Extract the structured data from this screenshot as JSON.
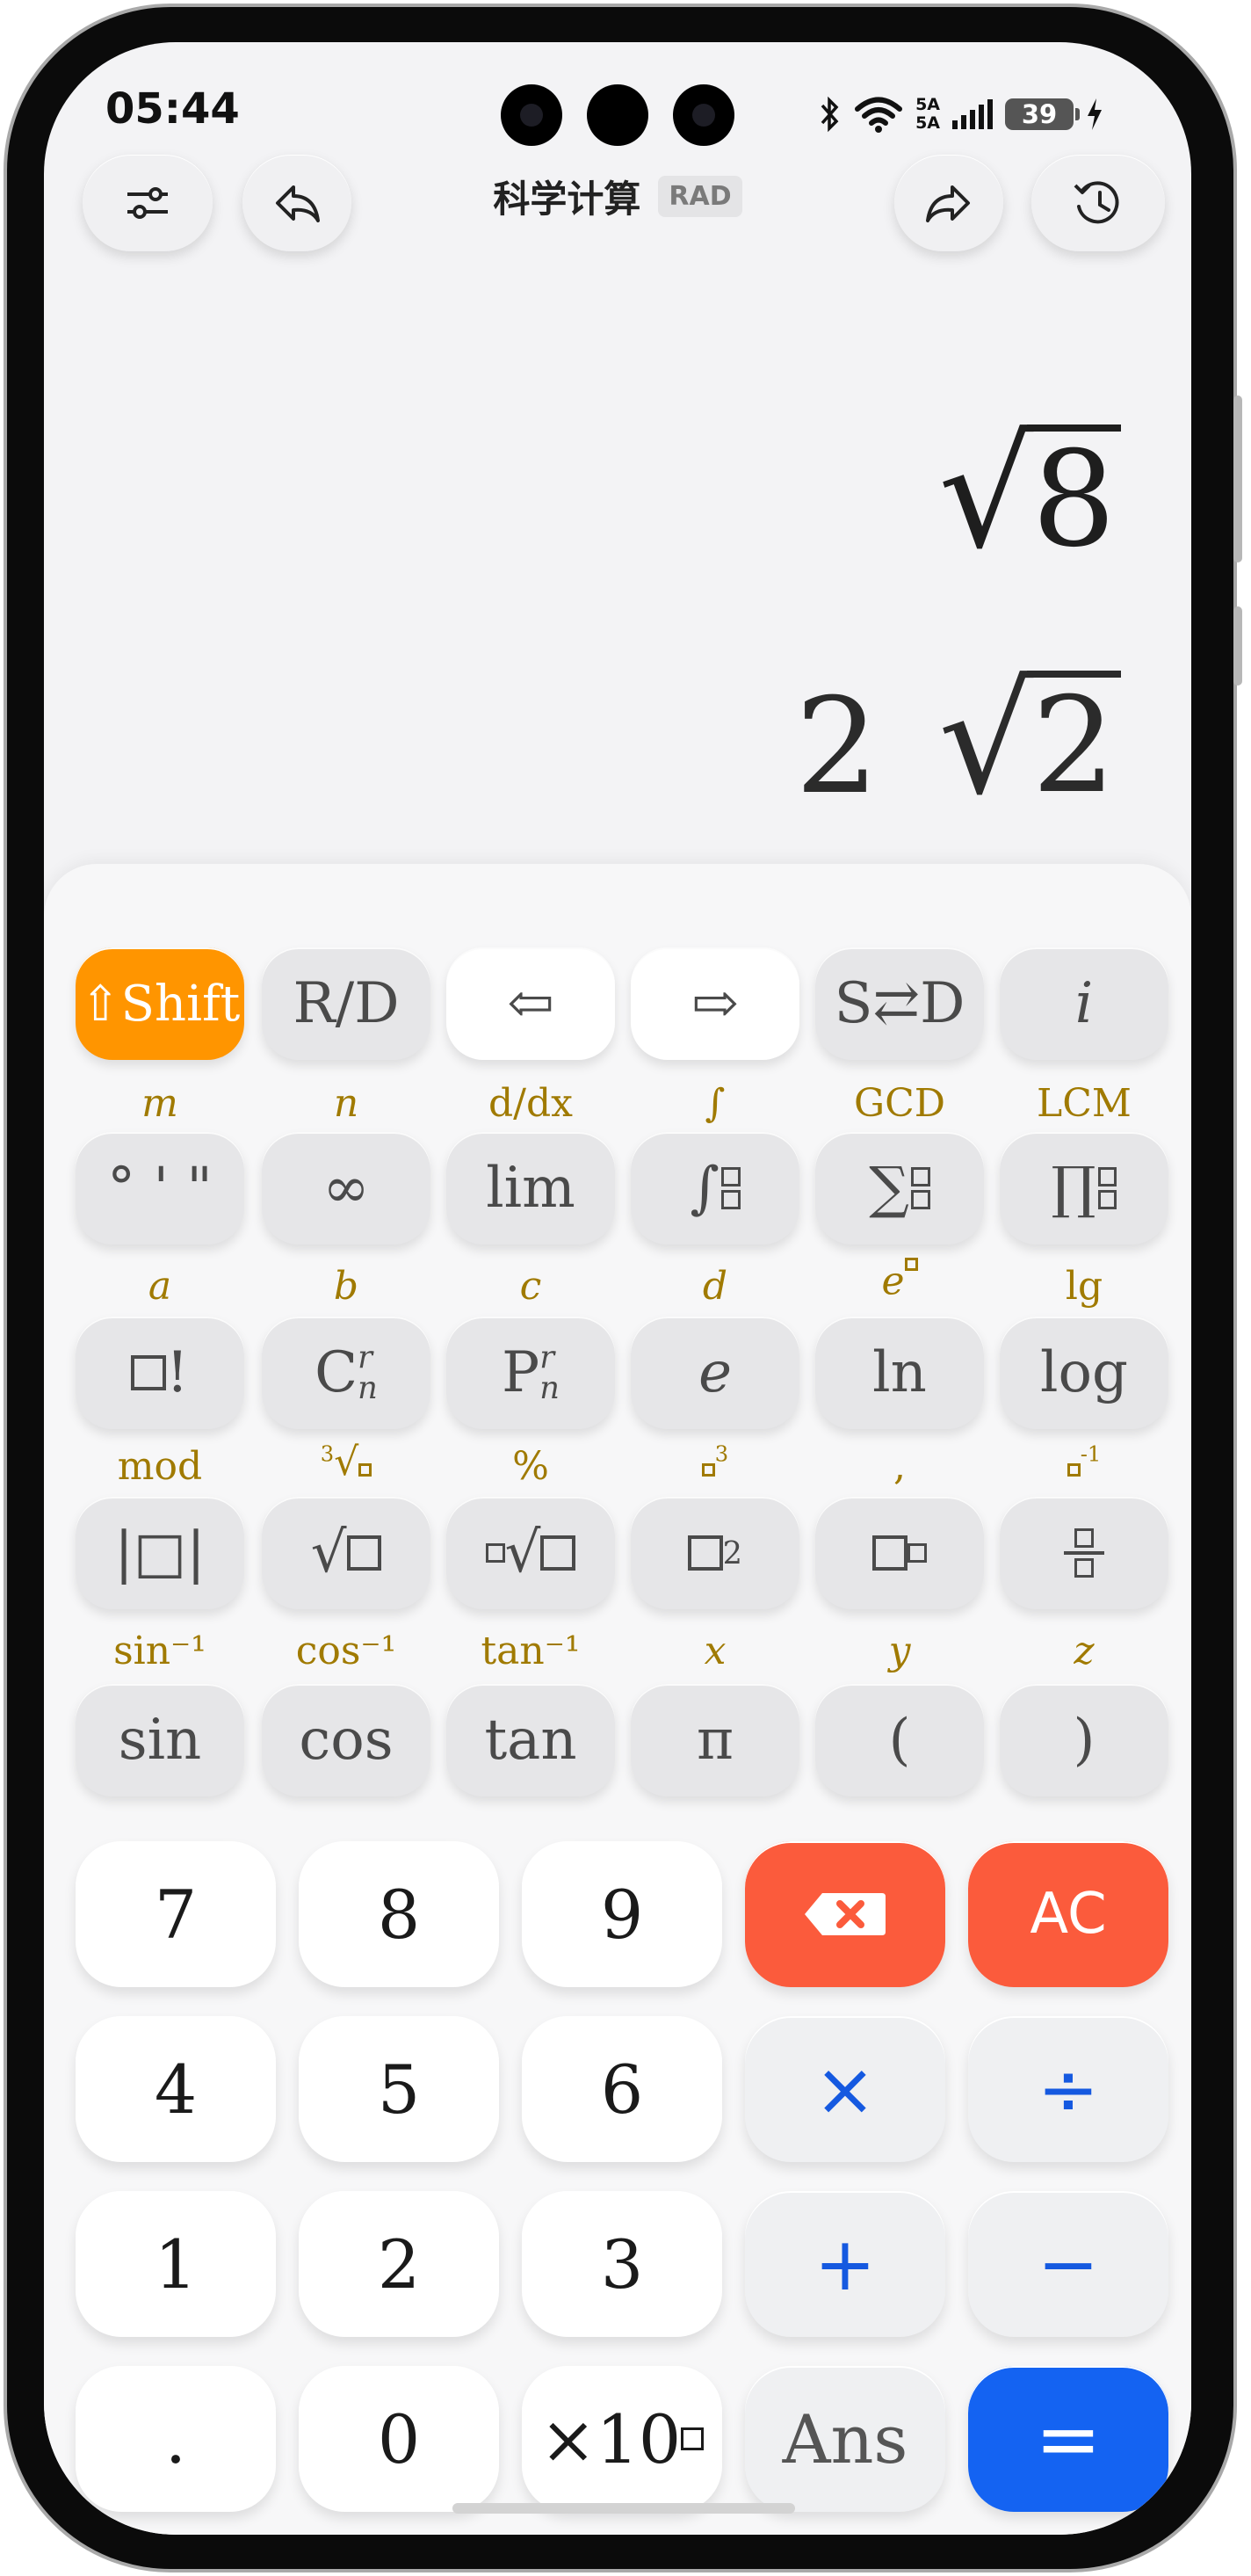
{
  "status_bar": {
    "time": "05:44",
    "network": "5A",
    "network2": "5A",
    "battery": "39"
  },
  "header": {
    "title": "科学计算",
    "angle_mode": "RAD"
  },
  "display": {
    "expression_radicand": "8",
    "result_coefficient": "2",
    "result_radicand": "2"
  },
  "function_keys": {
    "row1": [
      "⇧Shift",
      "R/D",
      "⇦",
      "⇨",
      "S⇄D",
      "i"
    ],
    "row2_secondary": [
      "m",
      "n",
      "d/dx",
      "∫",
      "GCD",
      "LCM"
    ],
    "row2": [
      "° ' \"",
      "∞",
      "lim",
      "∫",
      "∑",
      "∏"
    ],
    "row3_secondary": [
      "a",
      "b",
      "c",
      "d",
      "e",
      "lg"
    ],
    "row3": [
      "!",
      "C",
      "P",
      "e",
      "ln",
      "log"
    ],
    "row4_secondary": [
      "mod",
      "3",
      "%",
      "3",
      ",",
      "-1"
    ],
    "row4": [
      "|□|",
      "√",
      "√",
      "2",
      "□",
      "frac"
    ],
    "row5_secondary": [
      "sin⁻¹",
      "cos⁻¹",
      "tan⁻¹",
      "x",
      "y",
      "z"
    ],
    "row5": [
      "sin",
      "cos",
      "tan",
      "π",
      "(",
      ")"
    ]
  },
  "number_pad": {
    "row1": [
      "7",
      "8",
      "9",
      "⌫",
      "AC"
    ],
    "row2": [
      "4",
      "5",
      "6",
      "×",
      "÷"
    ],
    "row3": [
      "1",
      "2",
      "3",
      "+",
      "−"
    ],
    "row4": [
      ".",
      "0",
      "×10",
      "Ans",
      "="
    ]
  },
  "colors": {
    "shift": "#ff9500",
    "delete": "#fb5b3c",
    "equals": "#1463f2",
    "operator": "#1559e0",
    "secondary_label": "#a07a00"
  }
}
